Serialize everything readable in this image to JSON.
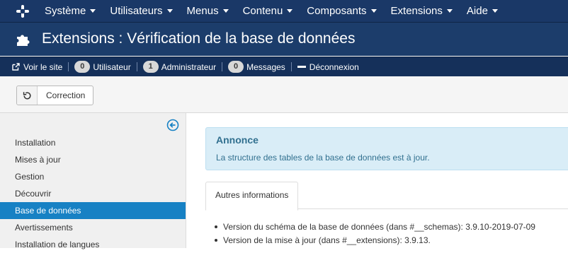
{
  "topnav": {
    "menu": [
      {
        "label": "Système"
      },
      {
        "label": "Utilisateurs"
      },
      {
        "label": "Menus"
      },
      {
        "label": "Contenu"
      },
      {
        "label": "Composants"
      },
      {
        "label": "Extensions"
      },
      {
        "label": "Aide"
      }
    ]
  },
  "header": {
    "title": "Extensions : Vérification de la base de données",
    "icon": "puzzle-icon"
  },
  "statusbar": {
    "view_site": "Voir le site",
    "users_count": "0",
    "users_label": "Utilisateur",
    "admins_count": "1",
    "admins_label": "Administrateur",
    "messages_count": "0",
    "messages_label": "Messages",
    "logout": "Déconnexion"
  },
  "toolbar": {
    "fix_label": "Correction"
  },
  "sidebar": {
    "active_index": 4,
    "items": [
      {
        "label": "Installation"
      },
      {
        "label": "Mises à jour"
      },
      {
        "label": "Gestion"
      },
      {
        "label": "Découvrir"
      },
      {
        "label": "Base de données"
      },
      {
        "label": "Avertissements"
      },
      {
        "label": "Installation de langues"
      }
    ]
  },
  "main": {
    "notice_heading": "Annonce",
    "notice_text": "La structure des tables de la base de données est à jour.",
    "tab_label": "Autres informations",
    "info": [
      {
        "text": "Version du schéma de la base de données (dans #__schemas): 3.9.10-2019-07-09"
      },
      {
        "text": "Version de la mise à jour (dans #__extensions): 3.9.13."
      }
    ]
  },
  "colors": {
    "topnav_bg": "#1a3867",
    "header_bg": "#1c3d6b",
    "statusbar_bg": "#15305a",
    "sidebar_active": "#1781c4",
    "notice_bg": "#d9edf7",
    "notice_text": "#31708f"
  }
}
